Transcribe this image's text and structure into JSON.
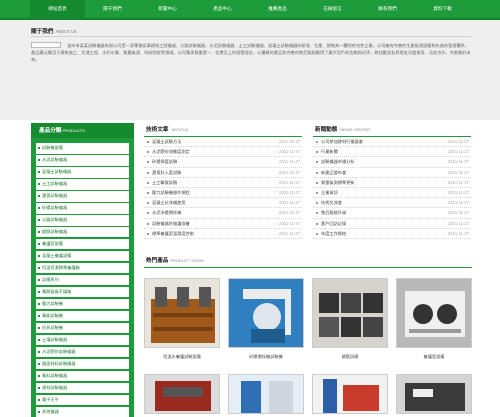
{
  "nav": {
    "items": [
      "網站首頁",
      "關于我們",
      "新聞中心",
      "產品中心",
      "推薦產品",
      "在線留言",
      "聯系我們",
      "資料下載"
    ],
    "active_index": 0,
    "color": "#1e9b3a"
  },
  "about": {
    "title": "關于我們",
    "title_en": "ABOUT US",
    "text": "滄州市某某試驗儀器有限公司是一家專業從事建筑工程儀器、公路試驗儀器、水泥試驗儀器、土工試驗儀器、混凝土試驗儀器的研發、生產、銷售為一體的綜合性企業。公司擁有完善的生產檢測設備和先進的管理體系，產品廣泛應用于建筑施工、交通工程、水利水電、質量檢測、科研院校等領域。公司秉承質量第一、信譽至上的經營理念，以優質的產品和完善的售后服務贏得了廣大用戶的信賴與好評，熱忱歡迎各界朋友光臨指導、洽談合作，共創美好未來。"
  },
  "sidebar": {
    "title": "產品分類",
    "title_en": "PRODUCTS",
    "items": [
      "試驗機設備",
      "水泥試驗儀器",
      "混凝土試驗儀器",
      "土工試驗儀器",
      "瀝青試驗儀器",
      "砂漿試驗儀器",
      "公路試驗儀器",
      "鋼筋試驗儀器",
      "養護室設備",
      "混凝土養護設備",
      "恒溫恒濕標準養護箱",
      "試模系列",
      "電熱鼓風干燥箱",
      "壓力試驗機",
      "萬能試驗機",
      "抗折試驗機",
      "土壤試驗儀器",
      "水泥膠砂試驗儀器",
      "路面材料試驗儀器",
      "集料試驗儀器",
      "建材試驗儀器",
      "電子天平",
      "其他儀器"
    ]
  },
  "tech": {
    "title": "技術文章",
    "title_en": "ARTICLE",
    "rows": [
      {
        "title": "混凝土試驗方法",
        "date": "2021-11-27"
      },
      {
        "title": "水泥膠砂流動度測定",
        "date": "2021-11-27"
      },
      {
        "title": "砂漿稠度試驗",
        "date": "2021-11-27"
      },
      {
        "title": "瀝青針入度試驗",
        "date": "2021-11-27"
      },
      {
        "title": "土工擊實試驗",
        "date": "2021-11-27"
      },
      {
        "title": "壓力試驗機操作規程",
        "date": "2021-11-27"
      },
      {
        "title": "混凝土抗滲儀使用",
        "date": "2021-11-27"
      },
      {
        "title": "水泥凈漿攪拌機",
        "date": "2021-11-27"
      },
      {
        "title": "試驗儀器的維護保養",
        "date": "2021-11-27"
      },
      {
        "title": "標準養護室溫濕度控制",
        "date": "2021-11-27"
      }
    ]
  },
  "news": {
    "title": "新聞動態",
    "title_en": "NEWS CENTER",
    "rows": [
      {
        "title": "公司參加建材行業展會",
        "date": "2021-11-27"
      },
      {
        "title": "行業新聞",
        "date": "2021-11-27"
      },
      {
        "title": "試驗儀器市場分析",
        "date": "2021-11-27"
      },
      {
        "title": "新產品發布會",
        "date": "2021-11-27"
      },
      {
        "title": "質量檢測標準更新",
        "date": "2021-11-27"
      },
      {
        "title": "企業資訊",
        "date": "2021-11-27"
      },
      {
        "title": "技術交流會",
        "date": "2021-11-27"
      },
      {
        "title": "售后服務升級",
        "date": "2021-11-27"
      },
      {
        "title": "客戶回訪記錄",
        "date": "2021-11-27"
      },
      {
        "title": "年度工作總結",
        "date": "2021-11-27"
      }
    ]
  },
  "hot": {
    "title": "熱門產品",
    "title_en": "PRODUCT SHOW",
    "items": [
      {
        "caption": "恒溫水養護試驗設備"
      },
      {
        "caption": "砂漿攪拌機試驗機"
      },
      {
        "caption": "鋼筋試模"
      },
      {
        "caption": "養護室設備"
      }
    ]
  }
}
